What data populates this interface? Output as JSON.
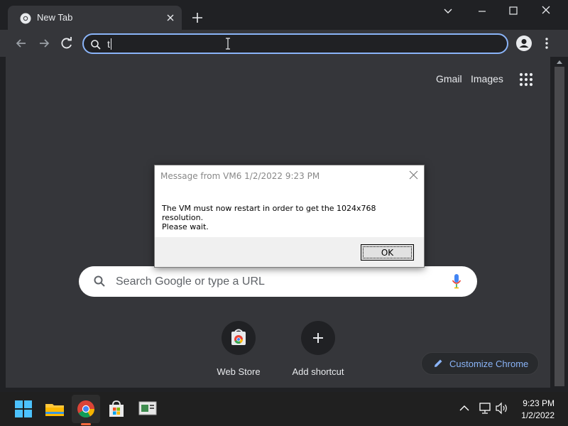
{
  "browser": {
    "tab_title": "New Tab",
    "omnibox_value": "t"
  },
  "ntp": {
    "gmail": "Gmail",
    "images": "Images",
    "search_placeholder": "Search Google or type a URL",
    "shortcuts": [
      {
        "label": "Web Store",
        "icon": "web-store-icon"
      },
      {
        "label": "Add shortcut",
        "icon": "plus-icon"
      }
    ],
    "customize": "Customize Chrome"
  },
  "dialog": {
    "title": "Message from VM6 1/2/2022 9:23 PM",
    "message_line1": "The VM must now restart in order to get the 1024x768 resolution.",
    "message_line2": "Please wait.",
    "ok": "OK"
  },
  "taskbar": {
    "time": "9:23 PM",
    "date": "1/2/2022",
    "icons": [
      "windows-start-icon",
      "file-explorer-icon",
      "chrome-icon",
      "microsoft-store-icon",
      "app-icon"
    ]
  },
  "colors": {
    "accent": "#8ab4f8",
    "page_bg": "#35363a",
    "chrome_frame": "#202124",
    "taskbar": "#202020"
  }
}
